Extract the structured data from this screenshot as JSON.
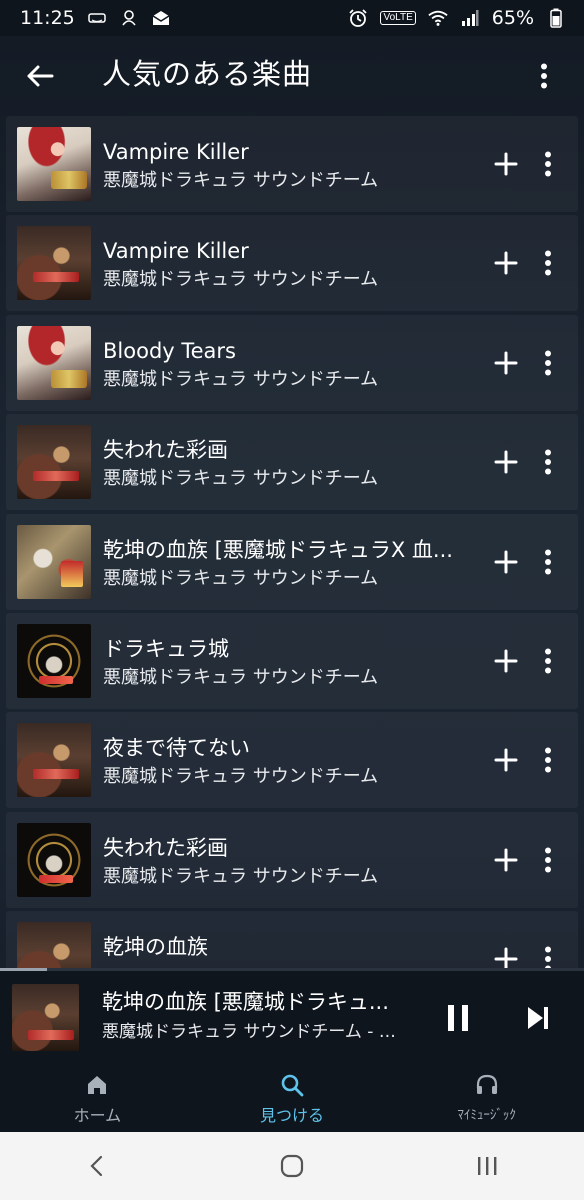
{
  "status_bar": {
    "time": "11:25",
    "volte_label": "VoLTE",
    "battery": "65%"
  },
  "header": {
    "title": "人気のある楽曲"
  },
  "tracks": [
    {
      "title": "Vampire Killer",
      "artist": "悪魔城ドラキュラ サウンドチーム",
      "art": "red"
    },
    {
      "title": "Vampire Killer",
      "artist": "悪魔城ドラキュラ サウンドチーム",
      "art": "dark"
    },
    {
      "title": "Bloody Tears",
      "artist": "悪魔城ドラキュラ サウンドチーム",
      "art": "red"
    },
    {
      "title": "失われた彩画",
      "artist": "悪魔城ドラキュラ サウンドチーム",
      "art": "dark"
    },
    {
      "title": "乾坤の血族 [悪魔城ドラキュラX 血...",
      "artist": "悪魔城ドラキュラ サウンドチーム",
      "art": "battle"
    },
    {
      "title": "ドラキュラ城",
      "artist": "悪魔城ドラキュラ サウンドチーム",
      "art": "gold"
    },
    {
      "title": "夜まで待てない",
      "artist": "悪魔城ドラキュラ サウンドチーム",
      "art": "dark"
    },
    {
      "title": "失われた彩画",
      "artist": "悪魔城ドラキュラ サウンドチーム",
      "art": "gold"
    },
    {
      "title": "乾坤の血族",
      "artist": "",
      "art": "dark"
    }
  ],
  "now_playing": {
    "title": "乾坤の血族 [悪魔城ドラキュ...",
    "subtitle": "悪魔城ドラキュラ サウンドチーム - 悪魔...",
    "progress": 0.08
  },
  "bottom_nav": {
    "items": [
      {
        "label": "ホーム",
        "icon": "home-icon",
        "active": false
      },
      {
        "label": "見つける",
        "icon": "search-icon",
        "active": true
      },
      {
        "label": "ﾏｲﾐｭｰｼﾞｯｸ",
        "icon": "headphones-icon",
        "active": false
      }
    ]
  },
  "colors": {
    "accent": "#5ec2ea",
    "background": "#1a2330",
    "bar": "#0f151d"
  }
}
